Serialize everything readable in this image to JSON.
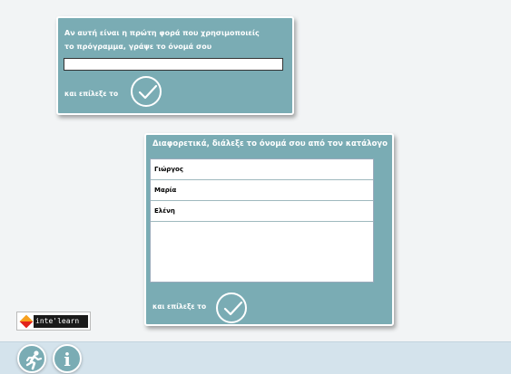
{
  "new_user": {
    "prompt_line1": "Αν αυτή είναι η πρώτη φορά που χρησιμοποιείς",
    "prompt_line2": "το πρόγραμμα, γράψε το όνομά σου",
    "name_value": "",
    "choose_label": "και επίλεξε το",
    "ok_icon": "checkmark-icon"
  },
  "existing_user": {
    "title": "Διαφορετικά, διάλεξε το όνομά σου από τον κατάλογο",
    "users": [
      "Γιώργος",
      "Μαρία",
      "Ελένη"
    ],
    "choose_label": "και επίλεξε το",
    "ok_icon": "checkmark-icon"
  },
  "branding": {
    "logo_text": "inte'learn"
  },
  "toolbar": {
    "exit_icon": "running-man-icon",
    "info_icon": "info-icon",
    "info_glyph": "i"
  },
  "colors": {
    "panel": "#7aacb4",
    "panel_border": "#ffffff",
    "bottom_bar": "#d4e3ec",
    "logo_orange": "#f7a01e",
    "logo_red": "#e2231a"
  }
}
